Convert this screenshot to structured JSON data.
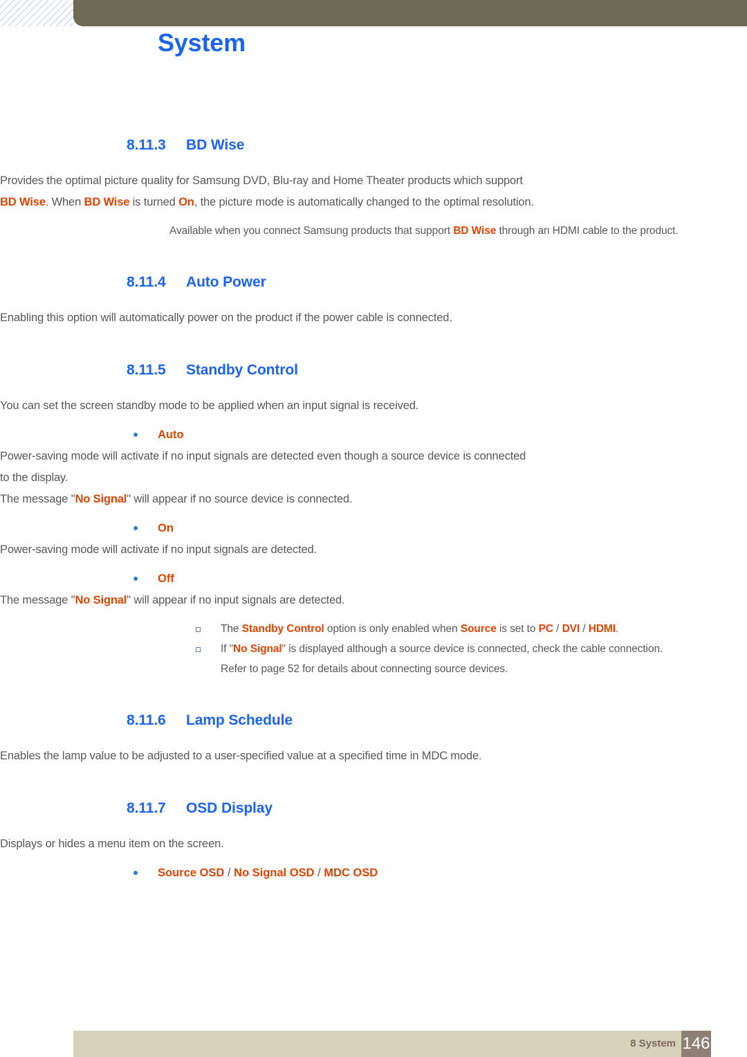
{
  "header": {
    "chapter_number": "8",
    "title": "System"
  },
  "sections": [
    {
      "number": "8.11.3",
      "title": "BD Wise",
      "paragraphs": [
        {
          "indent": "ind-0",
          "runs": [
            {
              "t": "Provides the optimal picture quality for Samsung DVD, Blu-ray and Home Theater products which support ",
              "k": false
            },
            {
              "t": "BD Wise",
              "k": true
            },
            {
              "t": ". When ",
              "k": false
            },
            {
              "t": "BD Wise",
              "k": true
            },
            {
              "t": " is turned ",
              "k": false
            },
            {
              "t": "On",
              "k": true
            },
            {
              "t": ", the picture mode is automatically changed to the optimal resolution.",
              "k": false
            }
          ]
        }
      ],
      "notes": [
        {
          "runs": [
            {
              "t": "Available when you connect Samsung products that support ",
              "k": false
            },
            {
              "t": "BD Wise",
              "k": true
            },
            {
              "t": " through an HDMI cable to the product.",
              "k": false
            }
          ]
        }
      ]
    },
    {
      "number": "8.11.4",
      "title": "Auto Power",
      "paragraphs": [
        {
          "indent": "ind-0",
          "runs": [
            {
              "t": "Enabling this option will automatically power on the product if the power cable is connected.",
              "k": false
            }
          ]
        }
      ]
    },
    {
      "number": "8.11.5",
      "title": "Standby Control",
      "paragraphs": [
        {
          "indent": "ind-0",
          "runs": [
            {
              "t": "You can set the screen standby mode to be applied when an input signal is received.",
              "k": false
            }
          ]
        }
      ],
      "bullets": [
        {
          "label_runs": [
            {
              "t": "Auto",
              "k": true
            }
          ],
          "body": [
            {
              "runs": [
                {
                  "t": "Power-saving mode will activate if no input signals are detected even though a source device is connected to the display.",
                  "k": false
                }
              ]
            },
            {
              "runs": [
                {
                  "t": "The message \"",
                  "k": false
                },
                {
                  "t": "No Signal",
                  "k": true
                },
                {
                  "t": "\" will appear if no source device is connected.",
                  "k": false
                }
              ]
            }
          ]
        },
        {
          "label_runs": [
            {
              "t": "On",
              "k": true
            }
          ],
          "body": [
            {
              "runs": [
                {
                  "t": "Power-saving mode will activate if no input signals are detected.",
                  "k": false
                }
              ]
            }
          ]
        },
        {
          "label_runs": [
            {
              "t": "Off",
              "k": true
            }
          ],
          "body": [
            {
              "runs": [
                {
                  "t": "The message \"",
                  "k": false
                },
                {
                  "t": "No Signal",
                  "k": true
                },
                {
                  "t": "\" will appear if no input signals are detected.",
                  "k": false
                }
              ]
            }
          ]
        }
      ],
      "square_notes": [
        {
          "runs": [
            {
              "t": "The ",
              "k": false
            },
            {
              "t": "Standby Control",
              "k": true
            },
            {
              "t": " option is only enabled when ",
              "k": false
            },
            {
              "t": "Source",
              "k": true
            },
            {
              "t": " is set to ",
              "k": false
            },
            {
              "t": "PC",
              "k": true
            },
            {
              "t": " / ",
              "k": false
            },
            {
              "t": "DVI",
              "k": true
            },
            {
              "t": " / ",
              "k": false
            },
            {
              "t": "HDMI",
              "k": true
            },
            {
              "t": ".",
              "k": false
            }
          ]
        },
        {
          "runs": [
            {
              "t": "If \"",
              "k": false
            },
            {
              "t": "No Signal",
              "k": true
            },
            {
              "t": "\" is displayed although a source device is connected, check the cable connection. Refer to page 52 for details about connecting source devices.",
              "k": false
            }
          ]
        }
      ]
    },
    {
      "number": "8.11.6",
      "title": "Lamp Schedule",
      "paragraphs": [
        {
          "indent": "ind-0",
          "runs": [
            {
              "t": "Enables the lamp value to be adjusted to a user-specified value at a specified time in MDC mode.",
              "k": false
            }
          ]
        }
      ]
    },
    {
      "number": "8.11.7",
      "title": "OSD Display",
      "paragraphs": [
        {
          "indent": "ind-0",
          "runs": [
            {
              "t": "Displays or hides a menu item on the screen.",
              "k": false
            }
          ]
        }
      ],
      "bullets": [
        {
          "label_runs": [
            {
              "t": "Source OSD",
              "k": true
            },
            {
              "t": " / ",
              "k": false
            },
            {
              "t": "No Signal OSD",
              "k": true
            },
            {
              "t": " / ",
              "k": false
            },
            {
              "t": "MDC OSD",
              "k": true
            }
          ],
          "body": []
        }
      ]
    }
  ],
  "footer": {
    "label": "8 System",
    "page_number": "146"
  },
  "colors": {
    "heading_blue": "#1a64f0",
    "keyword_orange": "#e04403",
    "body_gray": "#58585a",
    "header_olive": "#6d6b56",
    "footer_beige": "#d8d2bd",
    "footer_pagebox": "#8e7f74"
  }
}
